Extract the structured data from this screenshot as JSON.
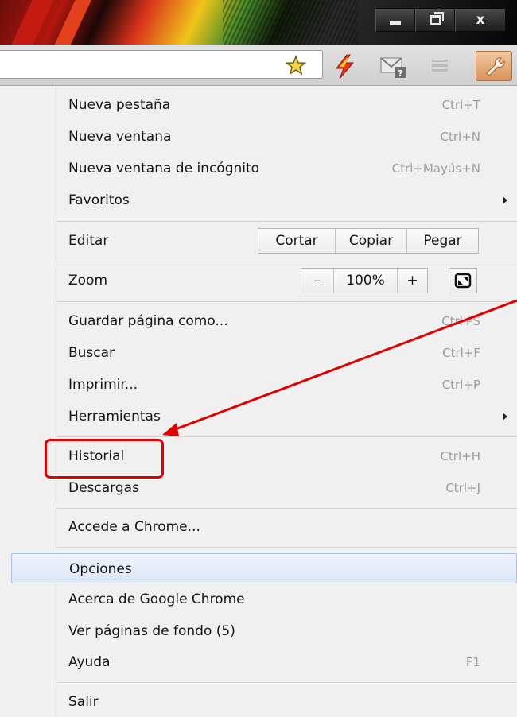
{
  "window": {
    "controls": {
      "minimize": "minimize",
      "restore": "restore",
      "close": "x"
    }
  },
  "toolbar": {
    "icons": [
      "star-icon",
      "bolt-extension-icon",
      "mail-checker-icon",
      "extension-icon",
      "wrench-icon"
    ],
    "wrench_color": "#d9925b"
  },
  "menu": {
    "items": [
      {
        "label": "Nueva pestaña",
        "shortcut": "Ctrl+T"
      },
      {
        "label": "Nueva ventana",
        "shortcut": "Ctrl+N"
      },
      {
        "label": "Nueva ventana de incógnito",
        "shortcut": "Ctrl+Mayús+N"
      },
      {
        "label": "Favoritos",
        "shortcut": ""
      },
      {
        "label": "Guardar página como...",
        "shortcut": "Ctrl+S"
      },
      {
        "label": "Buscar",
        "shortcut": "Ctrl+F"
      },
      {
        "label": "Imprimir...",
        "shortcut": "Ctrl+P"
      },
      {
        "label": "Herramientas",
        "shortcut": ""
      },
      {
        "label": "Historial",
        "shortcut": "Ctrl+H"
      },
      {
        "label": "Descargas",
        "shortcut": "Ctrl+J"
      },
      {
        "label": "Accede a Chrome...",
        "shortcut": ""
      },
      {
        "label": "Opciones",
        "shortcut": ""
      },
      {
        "label": "Acerca de Google Chrome",
        "shortcut": ""
      },
      {
        "label": "Ver páginas de fondo (5)",
        "shortcut": ""
      },
      {
        "label": "Ayuda",
        "shortcut": "F1"
      },
      {
        "label": "Salir",
        "shortcut": ""
      }
    ],
    "edit": {
      "label": "Editar",
      "cut": "Cortar",
      "copy": "Copiar",
      "paste": "Pegar"
    },
    "zoom": {
      "label": "Zoom",
      "minus": "–",
      "value": "100%",
      "plus": "+"
    },
    "highlighted_item": "Opciones",
    "annotated_item": "Historial",
    "annotation_color": "#e00000"
  }
}
